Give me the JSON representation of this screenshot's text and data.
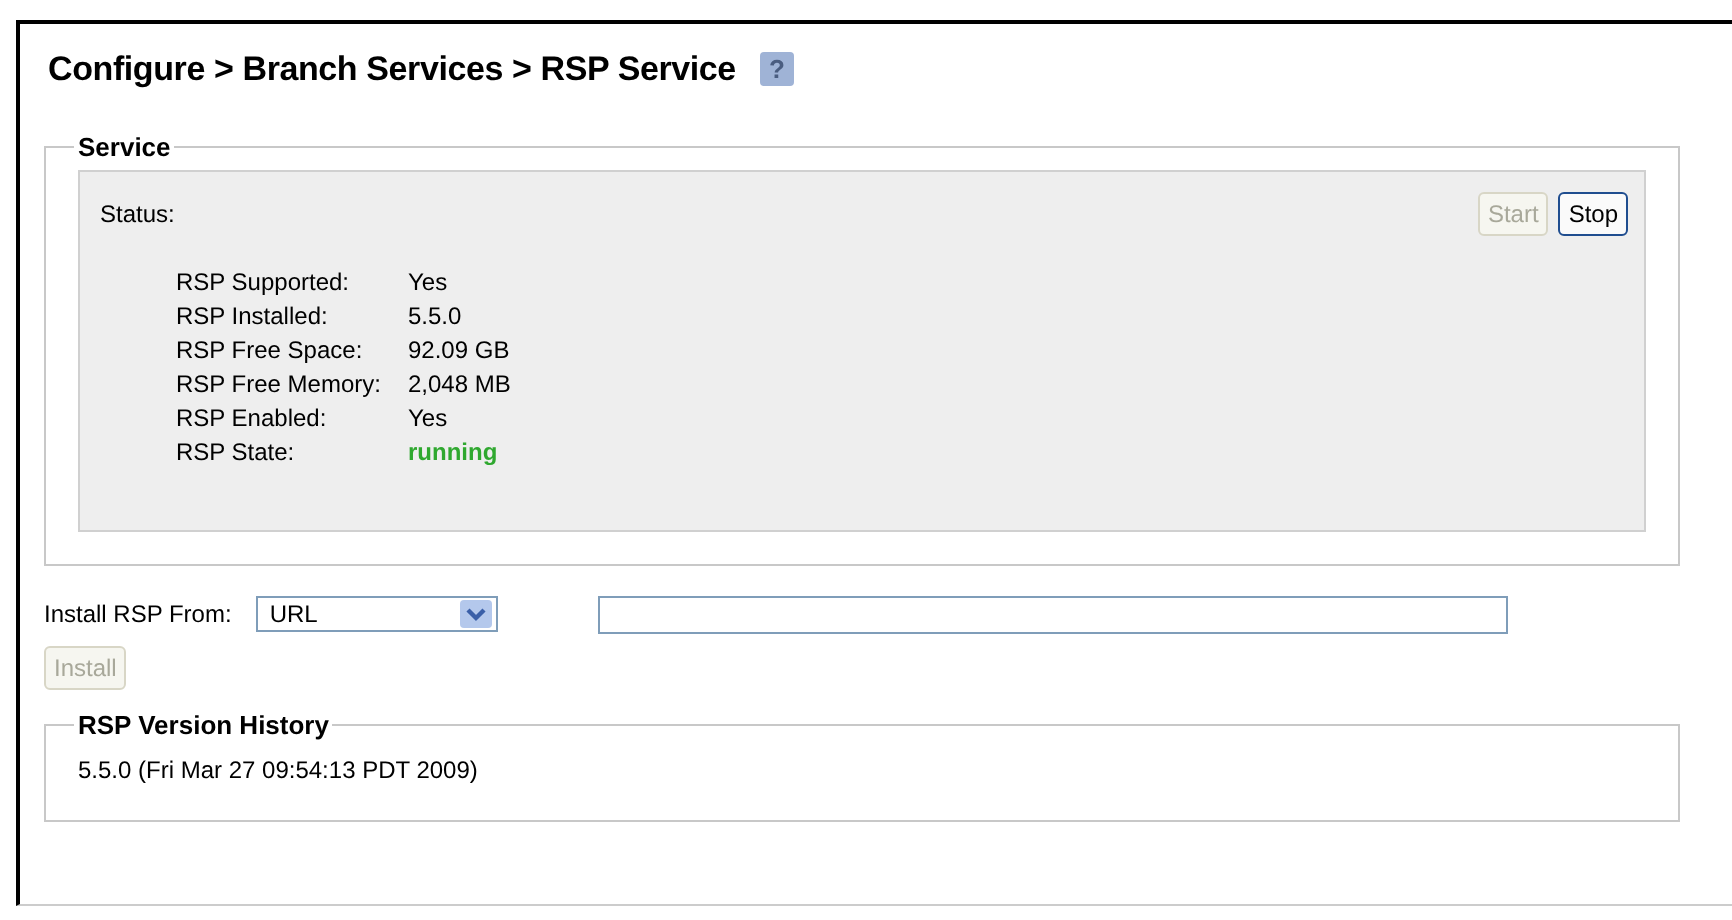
{
  "title": "Configure > Branch Services > RSP Service",
  "help": "?",
  "service": {
    "legend": "Service",
    "status_label": "Status:",
    "buttons": [
      {
        "label": "Start",
        "disabled": true
      },
      {
        "label": "Stop",
        "disabled": false
      }
    ],
    "rows": [
      {
        "label": "RSP Supported:",
        "value": "Yes",
        "kind": "plain"
      },
      {
        "label": "RSP Installed:",
        "value": "5.5.0",
        "kind": "plain"
      },
      {
        "label": "RSP Free Space:",
        "value": "92.09 GB",
        "kind": "plain"
      },
      {
        "label": "RSP Free Memory:",
        "value": "2,048 MB",
        "kind": "plain"
      },
      {
        "label": "RSP Enabled:",
        "value": "Yes",
        "kind": "plain"
      },
      {
        "label": "RSP State:",
        "value": "running",
        "kind": "state"
      }
    ]
  },
  "install": {
    "label": "Install RSP From:",
    "source": "URL",
    "button": {
      "label": "Install",
      "disabled": true
    }
  },
  "history": {
    "legend": "RSP Version History",
    "entries": [
      "5.5.0 (Fri Mar 27 09:54:13 PDT 2009)"
    ]
  }
}
